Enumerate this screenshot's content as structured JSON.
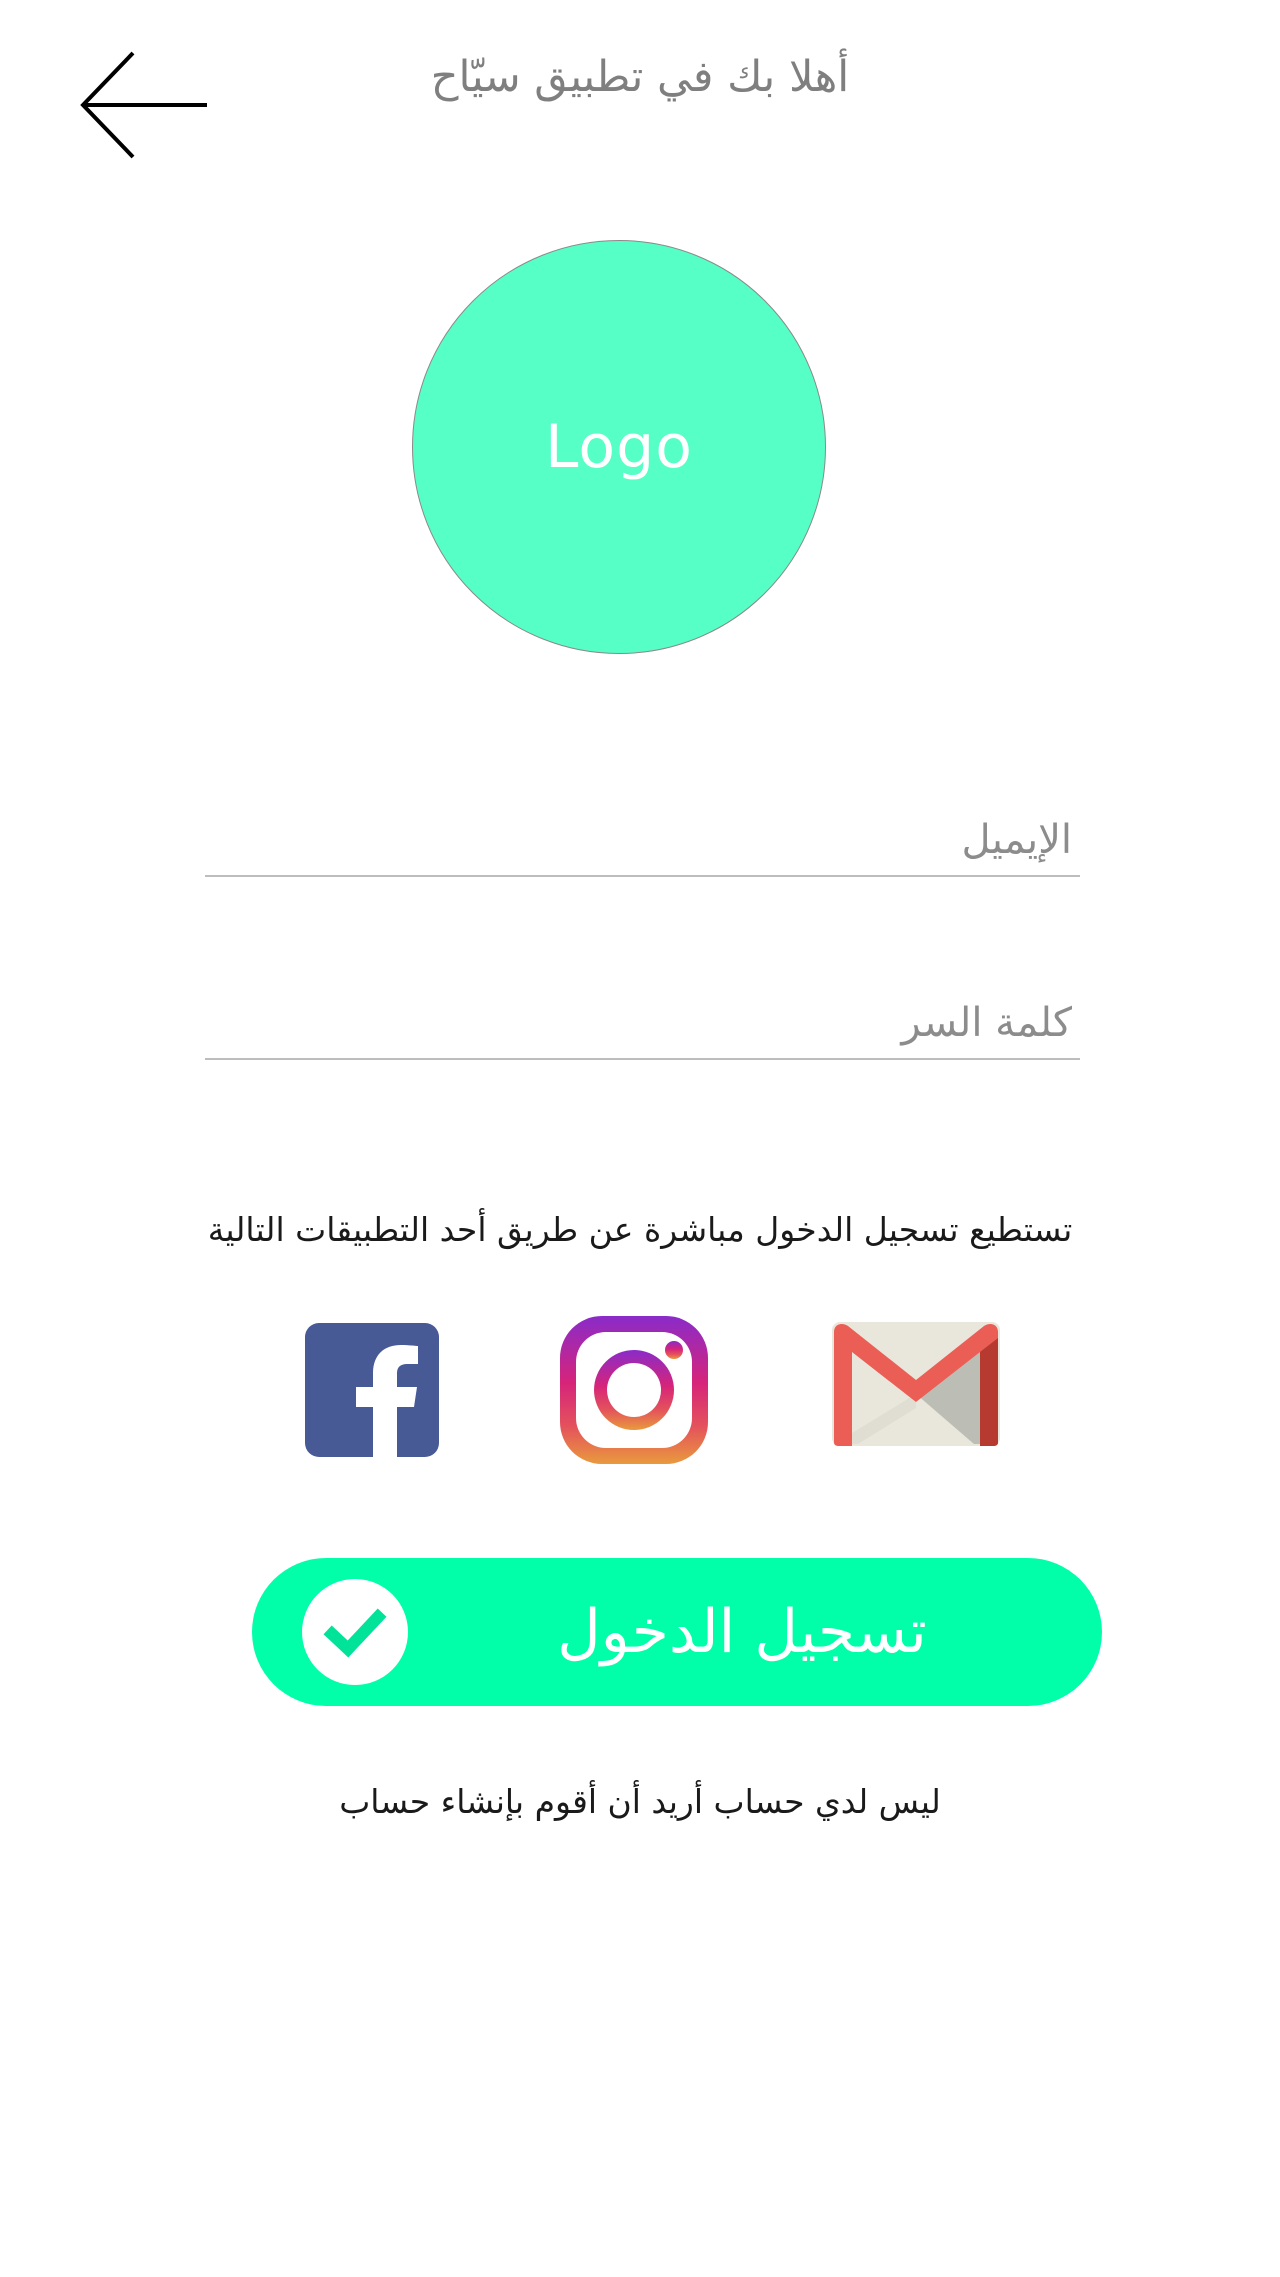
{
  "header": {
    "title": "أهلا بك في تطبيق سيّاح",
    "back_icon": "arrow-left-icon"
  },
  "logo": {
    "text": "Logo",
    "color": "#55ffc6"
  },
  "form": {
    "email_placeholder": "الإيميل",
    "password_placeholder": "كلمة السر"
  },
  "social": {
    "caption": "تستطيع تسجيل الدخول مباشرة عن طريق أحد التطبيقات التالية",
    "providers": [
      "facebook-icon",
      "instagram-icon",
      "gmail-icon"
    ]
  },
  "login": {
    "label": "تسجيل الدخول",
    "icon": "check-icon",
    "color": "#00ffa8"
  },
  "signup": {
    "text": "ليس لدي حساب أريد أن أقوم بإنشاء حساب"
  }
}
